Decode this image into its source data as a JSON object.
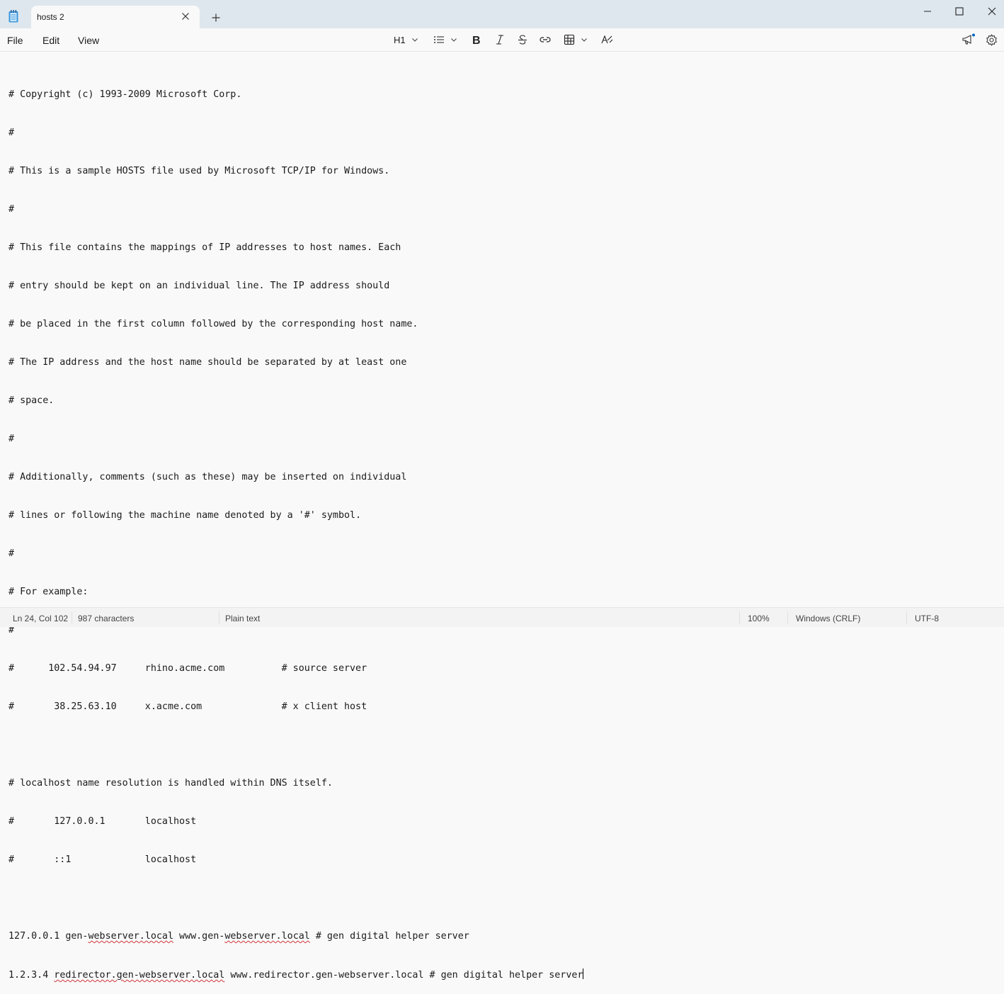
{
  "window": {
    "tab_title": "hosts 2",
    "icons": {
      "app": "notepad-icon",
      "close_tab": "close-icon",
      "new_tab": "plus-icon",
      "minimize": "minimize-icon",
      "maximize": "maximize-icon",
      "close": "close-icon"
    }
  },
  "menu": {
    "file": "File",
    "edit": "Edit",
    "view": "View"
  },
  "toolbar": {
    "heading": "H1",
    "icons": [
      "list-icon",
      "bold-icon",
      "italic-icon",
      "strikethrough-icon",
      "link-icon",
      "table-icon",
      "clear-formatting-icon",
      "announcement-icon",
      "settings-icon"
    ]
  },
  "editor": {
    "lines": [
      "# Copyright (c) 1993-2009 Microsoft Corp.",
      "#",
      "# This is a sample HOSTS file used by Microsoft TCP/IP for Windows.",
      "#",
      "# This file contains the mappings of IP addresses to host names. Each",
      "# entry should be kept on an individual line. The IP address should",
      "# be placed in the first column followed by the corresponding host name.",
      "# The IP address and the host name should be separated by at least one",
      "# space.",
      "#",
      "# Additionally, comments (such as these) may be inserted on individual",
      "# lines or following the machine name denoted by a '#' symbol.",
      "#",
      "# For example:",
      "#",
      "#      102.54.94.97     rhino.acme.com          # source server",
      "#       38.25.63.10     x.acme.com              # x client host",
      "",
      "# localhost name resolution is handled within DNS itself.",
      "#       127.0.0.1       localhost",
      "#       ::1             localhost",
      ""
    ],
    "line22": {
      "a": "127.0.0.1 gen-",
      "b": "webserver.local",
      "c": " www.gen-",
      "d": "webserver.local",
      "e": " # gen digital helper server"
    },
    "line23": {
      "a": "1.2.3.4 ",
      "b": "redirector.gen-webserver.local",
      "c": " www.redirector.gen-webserver.local # gen digital helper server"
    }
  },
  "status": {
    "position": "Ln 24, Col 102",
    "characters": "987 characters",
    "format": "Plain text",
    "zoom": "100%",
    "line_ending": "Windows (CRLF)",
    "encoding": "UTF-8"
  }
}
